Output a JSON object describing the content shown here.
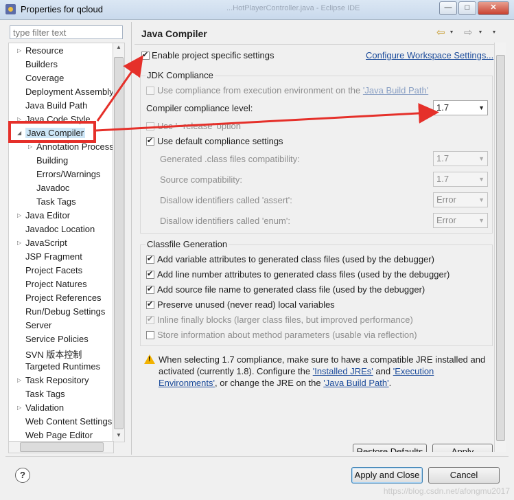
{
  "window": {
    "title": "Properties for qcloud",
    "bg_title": "...HotPlayerController.java - Eclipse IDE",
    "minimize": "—",
    "maximize": "□",
    "close": "✕"
  },
  "sidebar": {
    "filter_placeholder": "type filter text",
    "items": [
      {
        "label": "Resource",
        "expander": "▷"
      },
      {
        "label": "Builders"
      },
      {
        "label": "Coverage"
      },
      {
        "label": "Deployment Assembly"
      },
      {
        "label": "Java Build Path"
      },
      {
        "label": "Java Code Style",
        "expander": "▷"
      },
      {
        "label": "Java Compiler",
        "expander": "◢"
      },
      {
        "label": "Annotation Process",
        "expander": "▷"
      },
      {
        "label": "Building"
      },
      {
        "label": "Errors/Warnings"
      },
      {
        "label": "Javadoc"
      },
      {
        "label": "Task Tags"
      },
      {
        "label": "Java Editor",
        "expander": "▷"
      },
      {
        "label": "Javadoc Location"
      },
      {
        "label": "JavaScript",
        "expander": "▷"
      },
      {
        "label": "JSP Fragment"
      },
      {
        "label": "Project Facets"
      },
      {
        "label": "Project Natures"
      },
      {
        "label": "Project References"
      },
      {
        "label": "Run/Debug Settings"
      },
      {
        "label": "Server"
      },
      {
        "label": "Service Policies"
      },
      {
        "label": "SVN 版本控制"
      },
      {
        "label": "Targeted Runtimes"
      },
      {
        "label": "Task Repository",
        "expander": "▷"
      },
      {
        "label": "Task Tags"
      },
      {
        "label": "Validation",
        "expander": "▷"
      },
      {
        "label": "Web Content Settings"
      },
      {
        "label": "Web Page Editor"
      }
    ]
  },
  "page": {
    "title": "Java Compiler",
    "nav_back": "⇦",
    "nav_forward": "⇨",
    "menu": "▾",
    "enable_specific": "Enable project specific settings",
    "configure_link": "Configure Workspace Settings...",
    "jdk_group": "JDK Compliance",
    "use_compliance_from_env": "Use compliance from execution environment on the ",
    "java_build_path_link": "'Java Build Path'",
    "compliance_level_label": "Compiler compliance level:",
    "compliance_level_value": "1.7",
    "use_release": "Use '--release' option",
    "use_default": "Use default compliance settings",
    "generated_label": "Generated .class files compatibility:",
    "generated_value": "1.7",
    "source_label": "Source compatibility:",
    "source_value": "1.7",
    "assert_label": "Disallow identifiers called 'assert':",
    "assert_value": "Error",
    "enum_label": "Disallow identifiers called 'enum':",
    "enum_value": "Error",
    "classfile_group": "Classfile Generation",
    "cf1": "Add variable attributes to generated class files (used by the debugger)",
    "cf2": "Add line number attributes to generated class files (used by the debugger)",
    "cf3": "Add source file name to generated class file (used by the debugger)",
    "cf4": "Preserve unused (never read) local variables",
    "cf5": "Inline finally blocks (larger class files, but improved performance)",
    "cf6": "Store information about method parameters (usable via reflection)",
    "warn_l1": "When selecting 1.7 compliance, make sure to have a compatible JRE installed and",
    "warn_l2a": "activated (currently 1.8). Configure the ",
    "warn_link1": "'Installed JREs'",
    "warn_l2b": " and ",
    "warn_link2a": "'Execution",
    "warn_link2b": "Environments'",
    "warn_l3a": ", or change the JRE on the ",
    "warn_link3": "'Java Build Path'",
    "warn_l3b": ".",
    "restore_defaults": "Restore Defaults",
    "apply": "Apply"
  },
  "footer": {
    "help": "?",
    "apply_close": "Apply and Close",
    "cancel": "Cancel"
  },
  "watermark": "https://blog.csdn.net/afongmu2017"
}
